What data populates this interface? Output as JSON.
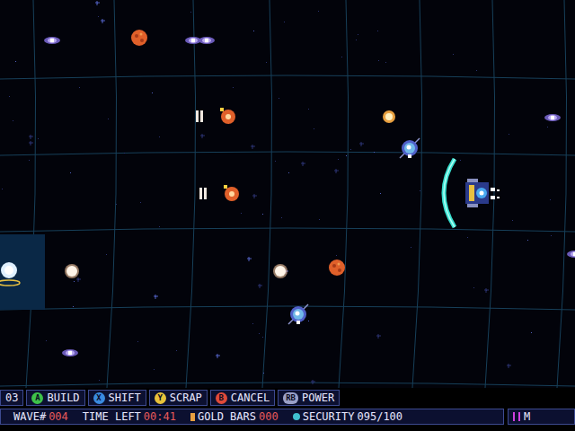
{
  "field": {
    "entities": [
      {
        "kind": "enemy"
      },
      {
        "kind": "planet"
      },
      {
        "kind": "enemy-pair"
      },
      {
        "kind": "enemy"
      },
      {
        "kind": "paused-enemy"
      },
      {
        "kind": "coin"
      },
      {
        "kind": "drone"
      },
      {
        "kind": "player"
      },
      {
        "kind": "paused-enemy"
      },
      {
        "kind": "base"
      },
      {
        "kind": "orb"
      },
      {
        "kind": "orb"
      },
      {
        "kind": "planet"
      },
      {
        "kind": "drone"
      },
      {
        "kind": "enemy"
      },
      {
        "kind": "enemy"
      }
    ]
  },
  "hud": {
    "counter": "03",
    "buttons": [
      {
        "key": "A",
        "label": "BUILD",
        "color": "#3ec24a"
      },
      {
        "key": "X",
        "label": "SHIFT",
        "color": "#3a8be0"
      },
      {
        "key": "Y",
        "label": "SCRAP",
        "color": "#e8c23a"
      },
      {
        "key": "B",
        "label": "CANCEL",
        "color": "#e04a3a"
      },
      {
        "key": "RB",
        "label": "POWER",
        "color": "#9aa0c8"
      }
    ],
    "stats": [
      {
        "label": "WAVE#",
        "value": "004",
        "kind": "plain",
        "color": "#e85a5a"
      },
      {
        "label": "TIME LEFT",
        "value": "00:41",
        "kind": "plain",
        "color": "#e85a5a"
      },
      {
        "label": "GOLD BARS",
        "value": "000",
        "kind": "gold",
        "color": "#e85a5a"
      },
      {
        "label": "SECURITY",
        "value": "095/100",
        "kind": "security",
        "color": "#e8e8ff"
      }
    ],
    "meter": {
      "label": "M"
    }
  }
}
